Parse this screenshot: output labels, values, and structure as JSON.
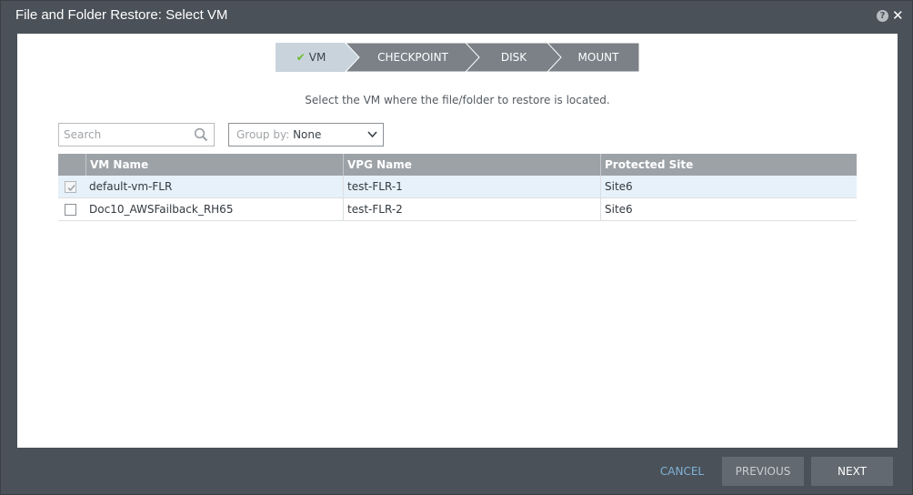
{
  "window": {
    "title": "File and Folder Restore: Select VM"
  },
  "wizard": {
    "steps": [
      {
        "label": "VM",
        "state": "completed-current"
      },
      {
        "label": "CHECKPOINT",
        "state": "pending"
      },
      {
        "label": "DISK",
        "state": "pending"
      },
      {
        "label": "MOUNT",
        "state": "pending"
      }
    ]
  },
  "instruction": "Select the VM where the file/folder to restore is located.",
  "search": {
    "placeholder": "Search"
  },
  "group_by": {
    "label": "Group by:",
    "value": "None"
  },
  "table": {
    "columns": [
      "VM Name",
      "VPG Name",
      "Protected Site"
    ],
    "rows": [
      {
        "checked": true,
        "vm_name": "default-vm-FLR",
        "vpg_name": "test-FLR-1",
        "protected_site": "Site6"
      },
      {
        "checked": false,
        "vm_name": "Doc10_AWSFailback_RH65",
        "vpg_name": "test-FLR-2",
        "protected_site": "Site6"
      }
    ]
  },
  "buttons": {
    "cancel": "CANCEL",
    "previous": "PREVIOUS",
    "next": "NEXT"
  },
  "colors": {
    "frame": "#4a5158",
    "active_step": "#c9d3dc",
    "inactive_step": "#7b8187",
    "check": "#6bbd2b",
    "header": "#9da2a7",
    "selected_row": "#e6f1fa",
    "cancel_link": "#7fb3d8"
  }
}
